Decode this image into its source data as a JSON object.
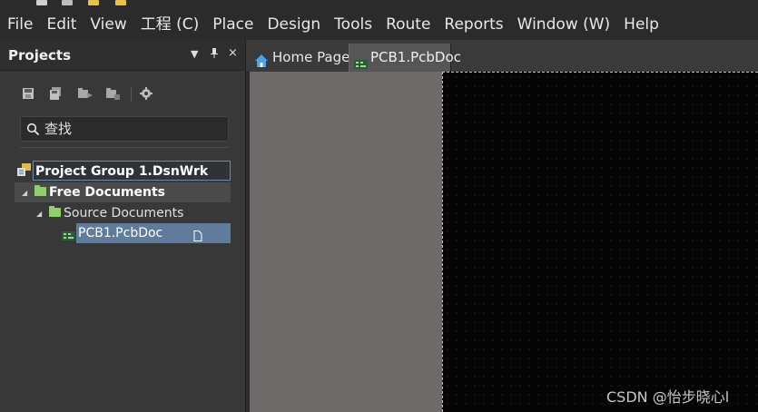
{
  "menu": [
    {
      "label": "File"
    },
    {
      "label": "Edit"
    },
    {
      "label": "View"
    },
    {
      "label": "工程 (C)"
    },
    {
      "label": "Place"
    },
    {
      "label": "Design"
    },
    {
      "label": "Tools"
    },
    {
      "label": "Route"
    },
    {
      "label": "Reports"
    },
    {
      "label": "Window (W)"
    },
    {
      "label": "Help"
    }
  ],
  "projects_panel": {
    "title": "Projects",
    "header_buttons": [
      "chevron-down-icon",
      "pin-icon",
      "close-icon"
    ],
    "toolbar_icons": [
      "save-icon",
      "save-all-icon",
      "open-project-icon",
      "close-project-icon",
      "settings-icon"
    ],
    "search": {
      "placeholder": "查找",
      "value": ""
    },
    "tree": {
      "group": "Project Group 1.DsnWrk",
      "free_documents": "Free Documents",
      "source_documents": "Source Documents",
      "pcb_file": "PCB1.PcbDoc"
    }
  },
  "doc_tabs": [
    {
      "label": "Home Page",
      "icon": "home-icon"
    },
    {
      "label": "PCB1.PcbDoc",
      "icon": "pcb-icon",
      "active": true
    }
  ],
  "watermark": "CSDN @怡步晓心l",
  "colors": {
    "panel_bg": "#383838",
    "selection": "#5f7c9c",
    "canvas_black": "#050505",
    "canvas_gray": "#6e6a69",
    "folder": "#8fcf6e"
  }
}
